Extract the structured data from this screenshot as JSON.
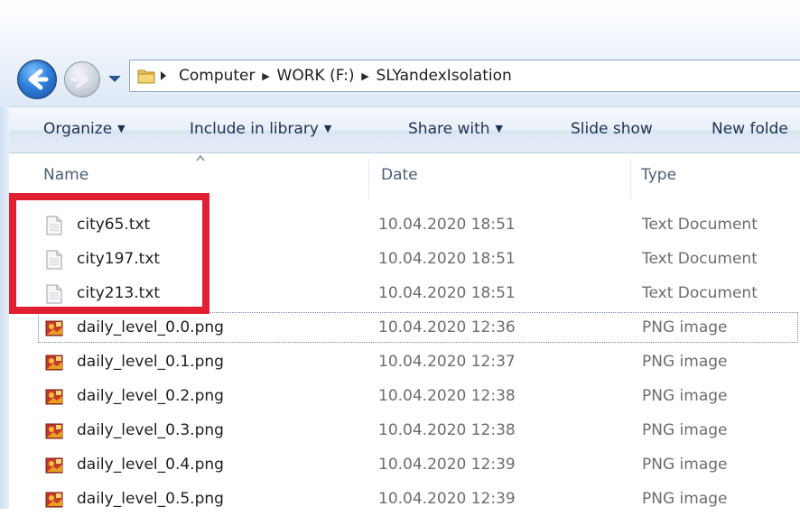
{
  "address": {
    "crumbs": [
      "Computer",
      "WORK (F:)",
      "SLYandexIsolation"
    ]
  },
  "toolbar": {
    "organize": "Organize",
    "include": "Include in library",
    "share": "Share with",
    "slideshow": "Slide show",
    "newfolder": "New folde"
  },
  "columns": {
    "name": "Name",
    "date": "Date",
    "type": "Type"
  },
  "files": [
    {
      "name": "city65.txt",
      "date": "10.04.2020 18:51",
      "type": "Text Document",
      "icon": "text-file-icon"
    },
    {
      "name": "city197.txt",
      "date": "10.04.2020 18:51",
      "type": "Text Document",
      "icon": "text-file-icon"
    },
    {
      "name": "city213.txt",
      "date": "10.04.2020 18:51",
      "type": "Text Document",
      "icon": "text-file-icon"
    },
    {
      "name": "daily_level_0.0.png",
      "date": "10.04.2020 12:36",
      "type": "PNG image",
      "icon": "png-file-icon"
    },
    {
      "name": "daily_level_0.1.png",
      "date": "10.04.2020 12:37",
      "type": "PNG image",
      "icon": "png-file-icon"
    },
    {
      "name": "daily_level_0.2.png",
      "date": "10.04.2020 12:38",
      "type": "PNG image",
      "icon": "png-file-icon"
    },
    {
      "name": "daily_level_0.3.png",
      "date": "10.04.2020 12:38",
      "type": "PNG image",
      "icon": "png-file-icon"
    },
    {
      "name": "daily_level_0.4.png",
      "date": "10.04.2020 12:39",
      "type": "PNG image",
      "icon": "png-file-icon"
    },
    {
      "name": "daily_level_0.5.png",
      "date": "10.04.2020 12:39",
      "type": "PNG image",
      "icon": "png-file-icon"
    }
  ],
  "colors": {
    "annotation": "#e02030",
    "accent": "#2f7fdc"
  }
}
